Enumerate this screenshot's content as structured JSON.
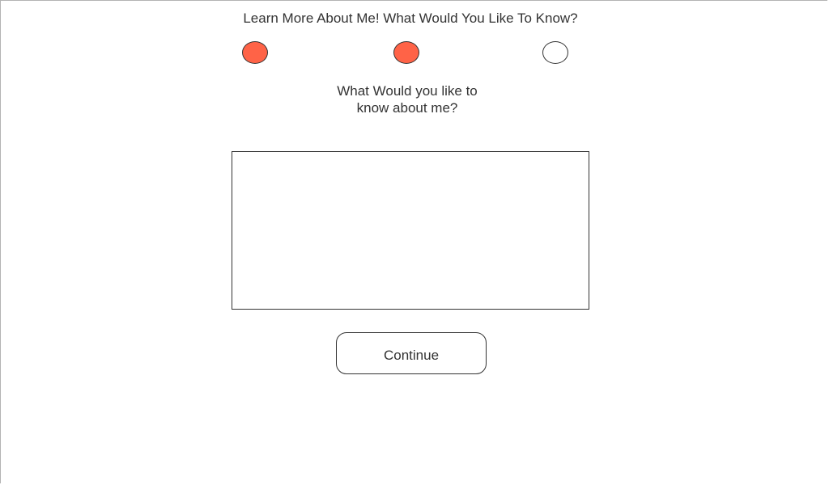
{
  "header": {
    "title": "Learn More About Me! What Would You Like To Know?"
  },
  "steps": [
    {
      "active": true
    },
    {
      "active": true
    },
    {
      "active": false
    }
  ],
  "question": {
    "line1": "What Would you like to",
    "line2": "know about me?"
  },
  "answer": {
    "value": "",
    "placeholder": ""
  },
  "actions": {
    "continue_label": "Continue"
  },
  "colors": {
    "step_active": "#ff6347",
    "step_inactive": "#ffffff",
    "text": "#333333",
    "border": "#333333"
  }
}
